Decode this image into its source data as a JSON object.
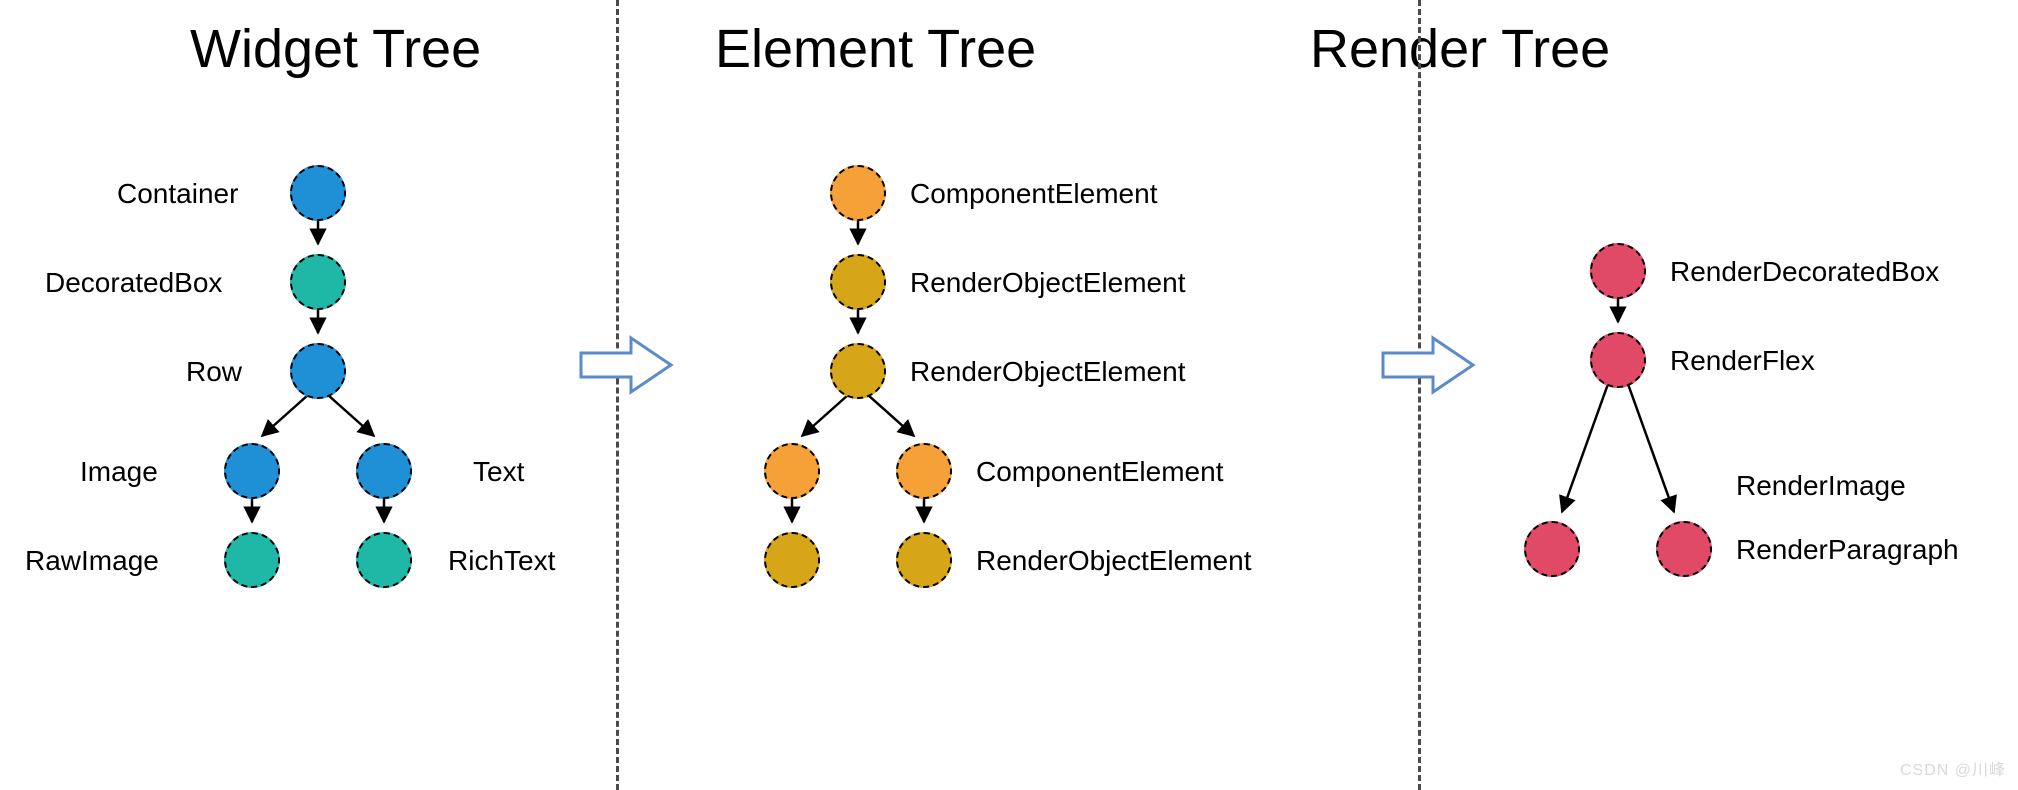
{
  "titles": {
    "widget": "Widget Tree",
    "element": "Element Tree",
    "render": "Render Tree"
  },
  "widget_tree": {
    "nodes": [
      {
        "id": "w1",
        "label": "Container",
        "color": "blue"
      },
      {
        "id": "w2",
        "label": "DecoratedBox",
        "color": "teal"
      },
      {
        "id": "w3",
        "label": "Row",
        "color": "blue"
      },
      {
        "id": "w4",
        "label": "Image",
        "color": "blue"
      },
      {
        "id": "w5",
        "label": "Text",
        "color": "blue"
      },
      {
        "id": "w6",
        "label": "RawImage",
        "color": "teal"
      },
      {
        "id": "w7",
        "label": "RichText",
        "color": "teal"
      }
    ],
    "edges": [
      [
        "w1",
        "w2"
      ],
      [
        "w2",
        "w3"
      ],
      [
        "w3",
        "w4"
      ],
      [
        "w3",
        "w5"
      ],
      [
        "w4",
        "w6"
      ],
      [
        "w5",
        "w7"
      ]
    ]
  },
  "element_tree": {
    "nodes": [
      {
        "id": "e1",
        "label": "ComponentElement",
        "color": "orange"
      },
      {
        "id": "e2",
        "label": "RenderObjectElement",
        "color": "gold"
      },
      {
        "id": "e3",
        "label": "RenderObjectElement",
        "color": "gold"
      },
      {
        "id": "e4",
        "label": "ComponentElement",
        "color": "orange"
      },
      {
        "id": "e5",
        "label": "ComponentElement",
        "color": "orange"
      },
      {
        "id": "e6",
        "label": "RenderObjectElement",
        "color": "gold"
      },
      {
        "id": "e7",
        "label": "RenderObjectElement",
        "color": "gold"
      }
    ],
    "edges": [
      [
        "e1",
        "e2"
      ],
      [
        "e2",
        "e3"
      ],
      [
        "e3",
        "e4"
      ],
      [
        "e3",
        "e5"
      ],
      [
        "e4",
        "e6"
      ],
      [
        "e5",
        "e7"
      ]
    ]
  },
  "render_tree": {
    "nodes": [
      {
        "id": "r1",
        "label": "RenderDecoratedBox",
        "color": "pink"
      },
      {
        "id": "r2",
        "label": "RenderFlex",
        "color": "pink"
      },
      {
        "id": "r3",
        "label": "RenderImage",
        "color": "pink"
      },
      {
        "id": "r4",
        "label": "RenderParagraph",
        "color": "pink"
      }
    ],
    "edges": [
      [
        "r1",
        "r2"
      ],
      [
        "r2",
        "r3"
      ],
      [
        "r2",
        "r4"
      ]
    ]
  },
  "colors": {
    "blue": "#1f8fd6",
    "teal": "#1fb8a6",
    "orange": "#f5a137",
    "gold": "#d6a518",
    "pink": "#e14a67",
    "arrow": "#5b8bc9"
  },
  "watermark": "CSDN @川峰"
}
